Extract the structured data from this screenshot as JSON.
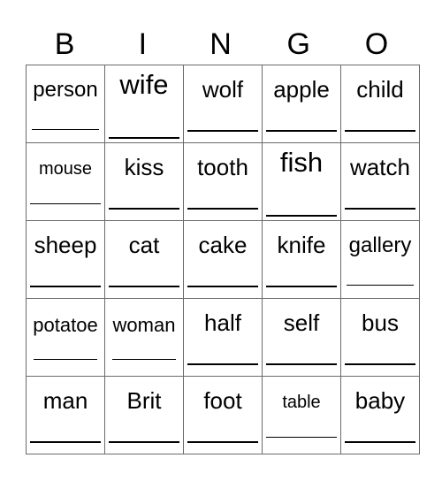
{
  "title": {
    "letters": [
      "B",
      "I",
      "N",
      "G",
      "O"
    ]
  },
  "board": {
    "rows": [
      [
        {
          "word": "person",
          "size": "s24"
        },
        {
          "word": "wife",
          "size": "s30"
        },
        {
          "word": "wolf",
          "size": "s26"
        },
        {
          "word": "apple",
          "size": "s26"
        },
        {
          "word": "child",
          "size": "s26"
        }
      ],
      [
        {
          "word": "mouse",
          "size": "s20"
        },
        {
          "word": "kiss",
          "size": "s26"
        },
        {
          "word": "tooth",
          "size": "s26"
        },
        {
          "word": "fish",
          "size": "s30"
        },
        {
          "word": "watch",
          "size": "s26"
        }
      ],
      [
        {
          "word": "sheep",
          "size": "s26"
        },
        {
          "word": "cat",
          "size": "s26"
        },
        {
          "word": "cake",
          "size": "s26"
        },
        {
          "word": "knife",
          "size": "s26"
        },
        {
          "word": "gallery",
          "size": "s24"
        }
      ],
      [
        {
          "word": "potatoe",
          "size": "s22"
        },
        {
          "word": "woman",
          "size": "s22"
        },
        {
          "word": "half",
          "size": "s26"
        },
        {
          "word": "self",
          "size": "s26"
        },
        {
          "word": "bus",
          "size": "s26"
        }
      ],
      [
        {
          "word": "man",
          "size": "s26"
        },
        {
          "word": "Brit",
          "size": "s26"
        },
        {
          "word": "foot",
          "size": "s26"
        },
        {
          "word": "table",
          "size": "s20"
        },
        {
          "word": "baby",
          "size": "s26"
        }
      ]
    ]
  }
}
